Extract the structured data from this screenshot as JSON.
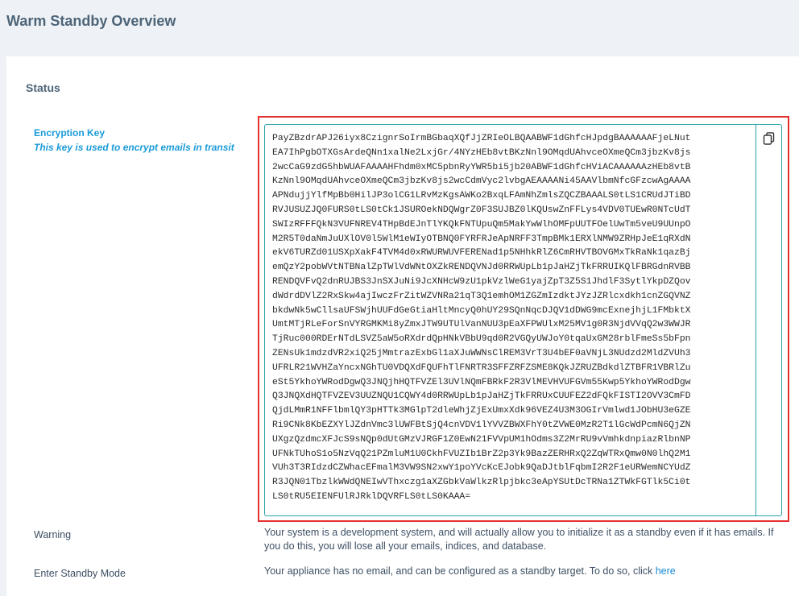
{
  "page": {
    "title": "Warm Standby Overview"
  },
  "status": {
    "section_title": "Status"
  },
  "encryption": {
    "label": "Encryption Key",
    "hint": "This key is used to encrypt emails in transit",
    "key_lines": [
      "PayZBzdrAPJ26iyx8CzignrSoIrmBGbaqXQfJjZRIeOLBQAABWF1dGhfcHJpdgBAAAAAAFjeLNut",
      "EA7IhPgbOTXGsArdeQNn1xalNe2LxjGr/4NYzHEb8vtBKzNnl9OMqdUAhvceOXmeQCm3jbzKv8js",
      "2wcCaG9zdG5hbWUAFAAAAHFhdm0xMC5pbnRyYWR5bi5jb20ABWF1dGhfcHViACAAAAAAzHEb8vtB",
      "KzNnl9OMqdUAhvceOXmeQCm3jbzKv8js2wcCdmVyc2lvbgAEAAAANi45AAVlbmNfcGFzcwAgAAAA",
      "APNdujjYlfMpBb0HilJP3olCG1LRvMzKgsAWKo2BxqLFAmNhZmlsZQCZBAAALS0tLS1CRUdJTiBD",
      "RVJUSUZJQ0FURS0tLS0tCk1JSUROekNDQWgrZ0F3SUJBZ0lKQUswZnFFLys4VDV0TUEwR0NTcUdT",
      "SWIzRFFFQkN3VUFNREV4THpBdEJnTlYKQkFNTUpuQm5MakYwWlhOMFpUUTFOelUwTm5veU9UUnpO",
      "M2R5T0daNmJuUXlOV0l5WlM1eWIyOTBNQ0FYRFRJeApNRFF3TmpBMk1ERXlNMW9ZRHpJeE1qRXdN",
      "ekV6TURZd01USXpXakF4TVM4d0xRWURWUVFERENad1p5NHhkRlZ6CmRHVTBOVGMxTkRaNk1qazBj",
      "emQzY2pobWVtNTBNalZpTWlVdWNtOXZkRENDQVNJd0RRWUpLb1pJaHZjTkFRRUIKQlFBRGdnRVBB",
      "RENDQVFvQ2dnRUJBS3JnSXJuNi9JcXNHcW9zU1pkVzlWeG1yajZpT3Z5S1JhdlF3SytlYkpDZQov",
      "dWdrdDVlZ2RxSkw4ajIwczFrZitWZVNRa21qT3Q1emhOM1ZGZmIzdktJYzJZRlcxdkh1cnZGQVNZ",
      "bkdwNk5wCllsaUFSWjhUUFdGeGtiaHltMncyQ0hUY29SQnNqcDJQV1dDWG9mcExnejhjL1FMbktX",
      "UmtMTjRLeForSnVYRGMKMi8yZmxJTW9UTUlVanNUU3pEaXFPWUlxM25MV1g0R3NjdVVqQ2w3WWJR",
      "TjRuc000RDErNTdLSVZ5aW5oRXdrdQpHNkVBbU9qd0R2VGQyUWJoY0tqaUxGM28rblFmeSs5bFpn",
      "ZENsUk1mdzdVR2xiQ25jMmtrazExbGl1aXJuWWNsClREM3VrT3U4bEF0aVNjL3NUdzd2MldZVUh3",
      "UFRLR21WVHZaYncxNGhTU0VDQXdFQUFhTlFNRTR3SFFZRFZSME8KQkJZRUZBdkdlZTBFR1VBRlZu",
      "eSt5YkhoYWRodDgwQ3JNQjhHQTFVZEl3UVlNQmFBRkF2R3VlMEVHVUFGVm55Kwp5YkhoYWRodDgw",
      "Q3JNQXdHQTFVZEV3UUZNQU1CQWY4d0RRWUpLb1pJaHZjTkFRRUxCUUFEZ2dFQkFISTI2OVV3CmFD",
      "QjdLMmR1NFFlbmlQY3pHTTk3MGlpT2dleWhjZjExUmxXdk96VEZ4U3M3OGIrVmlwd1JObHU3eGZE",
      "Ri9CNk8KbEZXYlJZdnVmc3lUWFBtSjQ4cnVDV1lYVVZBWXFhY0tZVWE0MzR2T1lGcWdPcmN6QjZN",
      "UXgzQzdmcXFJcS9sNQp0dUtGMzVJRGF1Z0EwN21FVVpUM1hOdms3Z2MrRU9vVmhkdnpiazRlbnNP",
      "UFNkTUhoS1o5NzVqQ21PZmluM1U0CkhFVUZIb1BrZ2p3Yk9BazZERHRxQ2ZqWTRxQmw0N0lhQ2M1",
      "VUh3T3RIdzdCZWhacEFmalM3VW9SN2xwY1poYVcKcEJobk9QaDJtblFqbmI2R2F1eURWemNCYUdZ",
      "R3JQN01TbzlkWWdQNEIwVThxczg1aXZGbkVaWlkzRlpjbkc3eApYSUtDcTRNa1ZTWkFGTlk5Ci0t",
      "LS0tRU5EIENFUlRJRklDQVRFLS0tLS0KAAA="
    ],
    "copy_icon": "copy-icon"
  },
  "warning": {
    "label": "Warning",
    "text": "Your system is a development system, and will actually allow you to initialize it as a standby even if it has emails. If you do this, you will lose all your emails, indices, and database."
  },
  "standby": {
    "label": "Enter Standby Mode",
    "text": "Your appliance has no email, and can be configured as a standby target. To do so, click ",
    "link_text": "here"
  }
}
